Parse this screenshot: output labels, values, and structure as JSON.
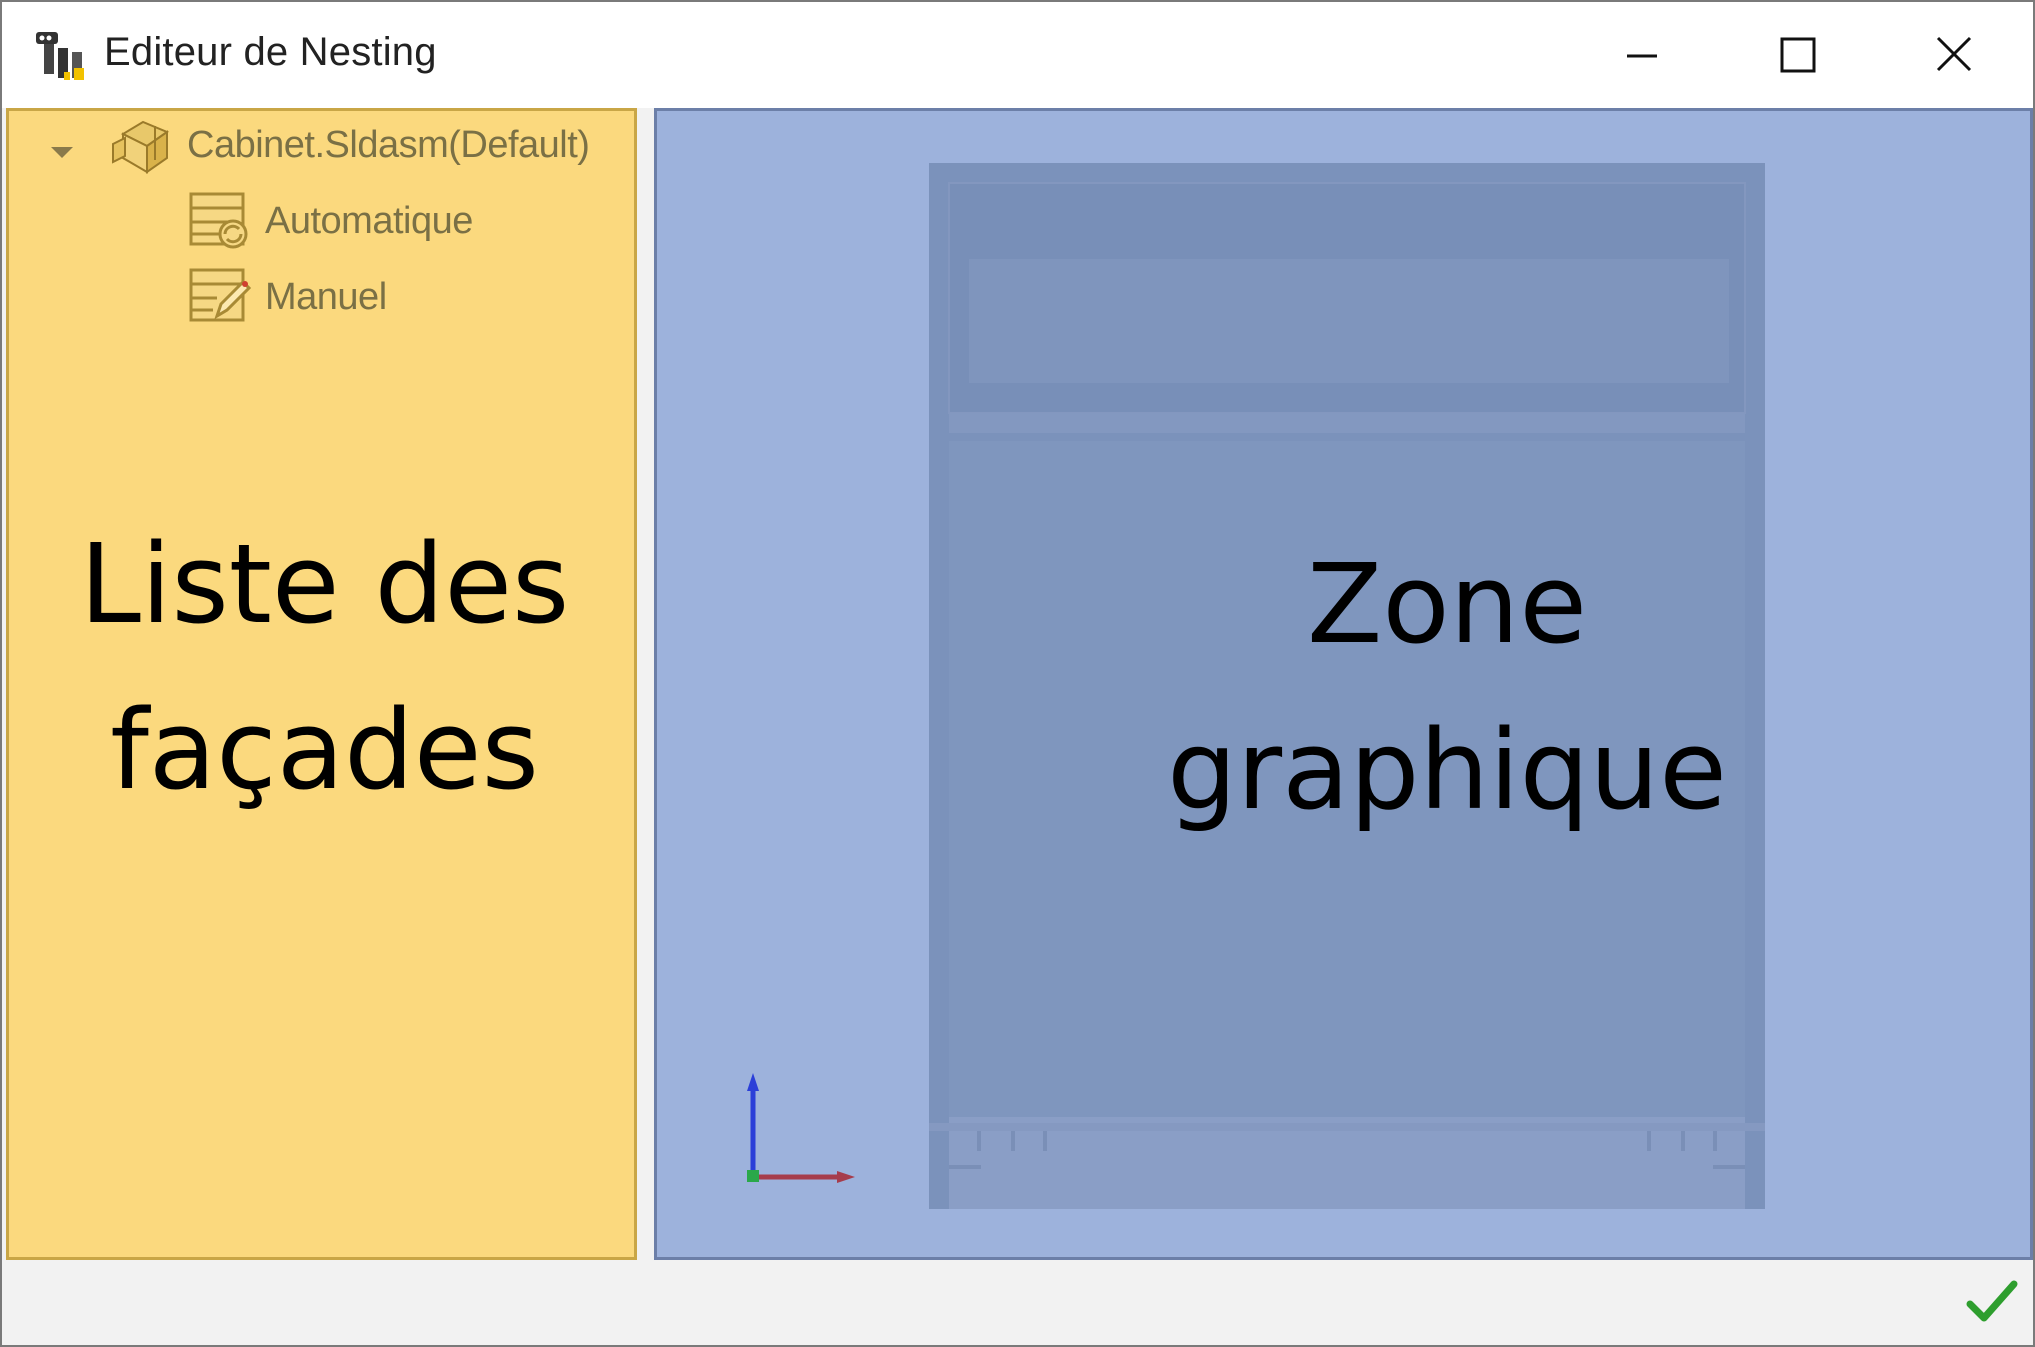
{
  "window": {
    "title": "Editeur de Nesting",
    "controls": [
      "minimize-icon",
      "maximize-icon",
      "close-icon"
    ]
  },
  "tree": {
    "root": {
      "label": "Cabinet.Sldasm(Default)",
      "icon": "assembly-icon",
      "expanded": true
    },
    "children": [
      {
        "label": "Automatique",
        "icon": "auto-nesting-icon"
      },
      {
        "label": "Manuel",
        "icon": "manual-nesting-icon"
      }
    ],
    "caption_line1": "Liste des",
    "caption_line2": "façades"
  },
  "graphics": {
    "caption_line1": "Zone",
    "caption_line2": "graphique",
    "triad_icon": "axis-triad-icon"
  },
  "statusbar": {
    "ok_icon": "checkmark-icon"
  },
  "colors": {
    "tree_panel_bg": "#fbd97e",
    "graphics_bg": "#9db2dc",
    "cabinet_fill": "#7b92bb",
    "ok_green": "#2e9e2e"
  }
}
